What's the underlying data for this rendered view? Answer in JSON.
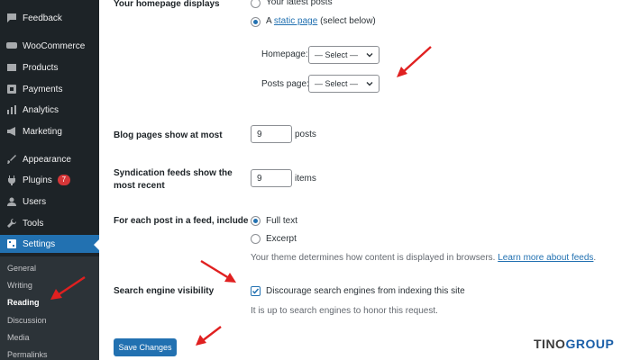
{
  "sidebar": {
    "items": [
      {
        "label": "Feedback",
        "icon": "feedback-icon"
      },
      {
        "label": "WooCommerce",
        "icon": "woocommerce-icon"
      },
      {
        "label": "Products",
        "icon": "products-icon"
      },
      {
        "label": "Payments",
        "icon": "payments-icon"
      },
      {
        "label": "Analytics",
        "icon": "analytics-icon"
      },
      {
        "label": "Marketing",
        "icon": "marketing-icon"
      },
      {
        "label": "Appearance",
        "icon": "appearance-icon"
      },
      {
        "label": "Plugins",
        "icon": "plugins-icon",
        "badge": "7"
      },
      {
        "label": "Users",
        "icon": "users-icon"
      },
      {
        "label": "Tools",
        "icon": "tools-icon"
      },
      {
        "label": "Settings",
        "icon": "settings-icon"
      }
    ],
    "submenu": [
      "General",
      "Writing",
      "Reading",
      "Discussion",
      "Media",
      "Permalinks"
    ]
  },
  "homepage": {
    "label": "Your homepage displays",
    "option_latest": "Your latest posts",
    "option_static_prefix": "A",
    "option_static_link": "static page",
    "option_static_suffix": "(select below)",
    "homepage_label": "Homepage:",
    "homepage_value": "— Select —",
    "posts_label": "Posts page:",
    "posts_value": "— Select —"
  },
  "blog_pages": {
    "label": "Blog pages show at most",
    "value": "9",
    "unit": "posts"
  },
  "syndication": {
    "label_line1": "Syndication feeds show the",
    "label_line2": "most recent",
    "value": "9",
    "unit": "items"
  },
  "feed": {
    "label": "For each post in a feed, include",
    "option_full": "Full text",
    "option_excerpt": "Excerpt",
    "help_text": "Your theme determines how content is displayed in browsers.",
    "help_link": "Learn more about feeds",
    "help_end": "."
  },
  "search": {
    "label": "Search engine visibility",
    "checkbox_label": "Discourage search engines from indexing this site",
    "help": "It is up to search engines to honor this request."
  },
  "save_label": "Save Changes",
  "logo": {
    "part1": "TINO",
    "part2": "GROUP"
  },
  "colors": {
    "accent": "#2271b1",
    "sidebar": "#1d2327",
    "arrow": "#e02020"
  }
}
